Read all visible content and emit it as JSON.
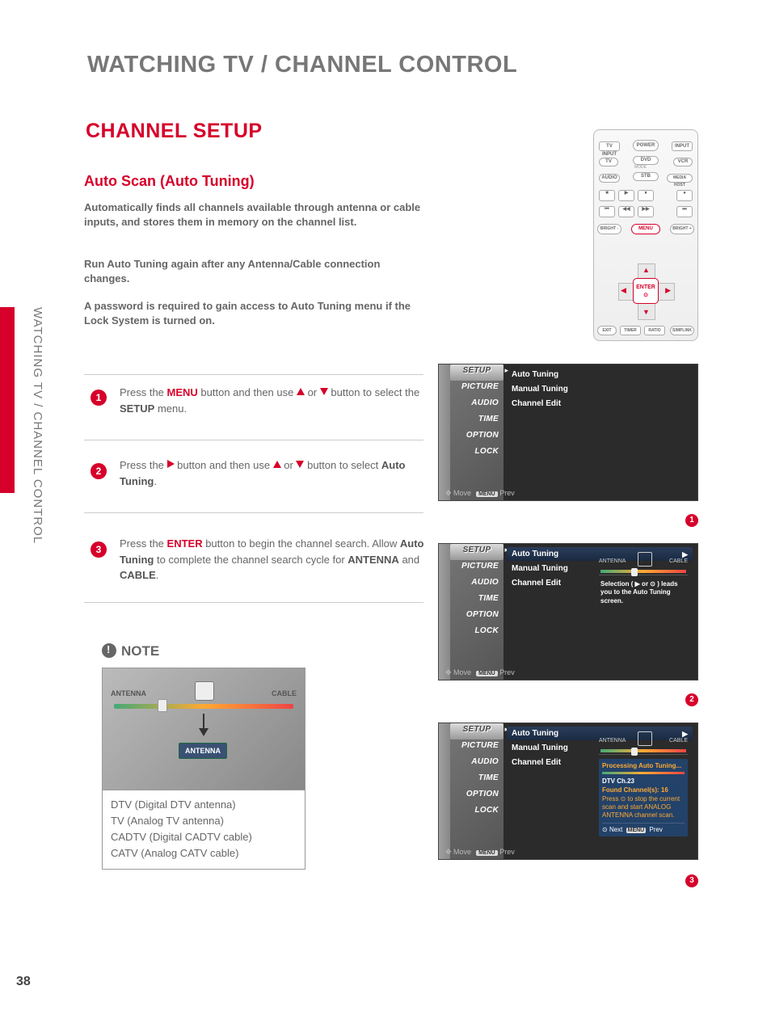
{
  "page_number": "38",
  "vertical_title": "WATCHING TV / CHANNEL CONTROL",
  "title": "WATCHING TV / CHANNEL CONTROL",
  "h1": "CHANNEL SETUP",
  "h2": "Auto Scan (Auto Tuning)",
  "intro": {
    "p1": "Automatically finds all channels available through antenna or cable inputs, and stores them in memory on the channel list.",
    "p2": "Run Auto Tuning again after any Antenna/Cable connection changes.",
    "p3": "A password is required to gain access to Auto Tuning menu if the Lock System is turned on."
  },
  "steps": {
    "s1a": "Press the ",
    "s1b": "MENU",
    "s1c": " button and then use ",
    "s1d": " or ",
    "s1e": " button to select the ",
    "s1f": "SETUP",
    "s1g": " menu.",
    "s2a": "Press the ",
    "s2b": " button and then use ",
    "s2c": " or ",
    "s2d": " button to select ",
    "s2e": "Auto Tuning",
    "s2f": ".",
    "s3a": "Press the ",
    "s3b": "ENTER",
    "s3c": " button to begin the channel search. Allow ",
    "s3d": "Auto Tuning",
    "s3e": " to complete the channel search cycle for ",
    "s3f": "ANTENNA",
    "s3g": " and ",
    "s3h": "CABLE",
    "s3i": "."
  },
  "remote": {
    "top": {
      "tvinput": "TV INPUT",
      "power": "POWER",
      "input": "INPUT"
    },
    "r2": {
      "tv": "TV",
      "dvd": "DVD",
      "vcr": "VCR",
      "mode": "MODE",
      "sth": "STB"
    },
    "r3": {
      "audio": "AUDIO",
      "media": "MEDIA HOST"
    },
    "menu": "MENU",
    "bright_m": "BRIGHT -",
    "bright_p": "BRIGHT +",
    "enter": "ENTER",
    "bot": {
      "exit": "EXIT",
      "timer": "TIMER",
      "ratio": "RATIO",
      "simplink": "SIMPLINK"
    }
  },
  "osd": {
    "menu": [
      "SETUP",
      "PICTURE",
      "AUDIO",
      "TIME",
      "OPTION",
      "LOCK"
    ],
    "submenu": [
      "Auto Tuning",
      "Manual Tuning",
      "Channel Edit"
    ],
    "foot_move": "Move",
    "foot_menu": "MENU",
    "foot_prev": "Prev",
    "antenna_l": "ANTENNA",
    "antenna_r": "CABLE",
    "hint": "Selection ( ▶ or ⊙ ) leads you to the Auto Tuning screen.",
    "popup": {
      "title": "Processing Auto Tuning...",
      "l1": "DTV Ch.23",
      "l2": "Found Channel(s): 16",
      "l3": "Press ⊙ to stop the current scan and start ANALOG ANTENNA channel  scan.",
      "next": "Next",
      "menu": "MENU",
      "prev": "Prev"
    }
  },
  "note": {
    "header": "NOTE",
    "ant_l": "ANTENNA",
    "ant_r": "CABLE",
    "ant_mid": "ANTENNA",
    "lines": [
      "DTV (Digital DTV antenna)",
      "TV (Analog TV antenna)",
      "CADTV (Digital CADTV cable)",
      "CATV (Analog CATV cable)"
    ]
  }
}
